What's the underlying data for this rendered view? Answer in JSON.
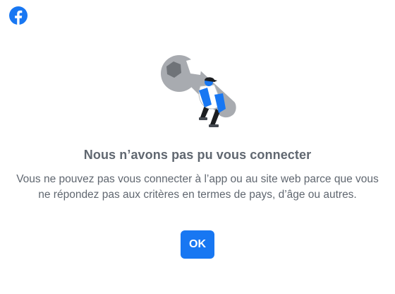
{
  "header": {
    "logo_icon": "facebook-logo-icon"
  },
  "illustration": {
    "icon": "wrench-with-person-illustration"
  },
  "dialog": {
    "title": "Nous n’avons pas pu vous connecter",
    "message": "Vous ne pouvez pas vous connecter à l’app ou au site web parce que vous ne répondez pas aux critères en termes de pays, d’âge ou autres.",
    "ok_label": "OK"
  },
  "colors": {
    "brand_blue": "#1877f2",
    "text_gray": "#606770",
    "wrench_gray": "#a8abb0",
    "hex_gray": "#6f7378"
  }
}
